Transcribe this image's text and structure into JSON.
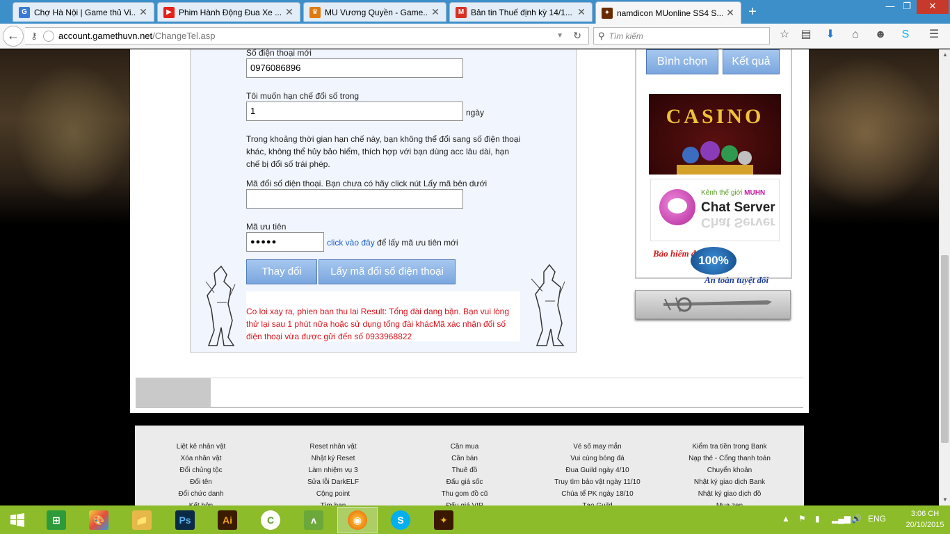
{
  "tabs": [
    {
      "title": "Chợ Hà Nội | Game thủ Vi...",
      "icon": "g-site-icon",
      "glyph": "G",
      "color": "#3a7bd5"
    },
    {
      "title": "Phim Hành Động Đua Xe ...",
      "icon": "youtube-icon",
      "glyph": "▶",
      "color": "#e62117"
    },
    {
      "title": "MU Vương Quyền - Game...",
      "icon": "crown-icon",
      "glyph": "♛",
      "color": "#e07a10"
    },
    {
      "title": "Bản tin Thuế định kỳ 14/1...",
      "icon": "gmail-icon",
      "glyph": "M",
      "color": "#d93025"
    },
    {
      "title": "namdicon MUonline SS4 S...",
      "icon": "mu-site-icon",
      "glyph": "✦",
      "color": "#6a2a00"
    }
  ],
  "address": {
    "host": "account.gamethuvn.net",
    "path": "/ChangeTel.asp"
  },
  "search": {
    "placeholder": "Tìm kiếm"
  },
  "form": {
    "new_phone_label": "Số điện thoại mới",
    "new_phone_value": "0976086896",
    "limit_label": "Tôi muốn hạn chế đổi số trong",
    "limit_value": "1",
    "limit_unit": "ngày",
    "limit_note": "Trong khoảng thời gian hạn chế này, bạn không thể đổi sang số điện thoại khác, không thể hủy bảo hiểm, thích hợp với bạn dùng acc lâu dài, hạn chế bị đổi số trái phép.",
    "code_label": "Mã đổi số điện thoại. Bạn chưa có hãy click nút Lấy mã bên dưới",
    "code_value": "",
    "priority_label": "Mã ưu tiên",
    "priority_value": "●●●●●",
    "priority_link": "click vào đây",
    "priority_hint": "để lấy mã ưu tiên mới",
    "change_button": "Thay đổi",
    "get_code_button": "Lấy mã đổi số điện thoại",
    "error_message": "Co loi xay ra, phien ban thu lai Result: Tổng đài đang bận. Bạn vui lòng thử lại sau 1 phút nữa hoặc sử dụng tổng đài khácMã xác nhận đổi số điện thoại vừa được gửi đến số 0933968822"
  },
  "sidebar": {
    "vote_button": "Bình chọn",
    "result_button": "Kết quả",
    "casino_text": "CASINO",
    "chat_kicker": "Kênh thế giới",
    "chat_brand": "MUHN",
    "chat_title": "Chat Server",
    "insurance_title": "Bảo hiểm đổ",
    "insurance_seal": "100%",
    "insurance_sub": "An toàn tuyệt đối"
  },
  "footer": {
    "columns": [
      [
        "Liệt kê nhân vật",
        "Xóa nhân vật",
        "Đổi chủng tộc",
        "Đổi tên",
        "Đổi chức danh",
        "Kết hôn"
      ],
      [
        "Reset nhân vật",
        "Nhật ký Reset",
        "Làm nhiệm vụ 3",
        "Sửa lỗi DarkELF",
        "Cộng point",
        "Tìm bạn"
      ],
      [
        "Cần mua",
        "Cần bán",
        "Thuê đồ",
        "Đấu giá sốc",
        "Thu gom đồ cũ",
        "Đấu giá VIP"
      ],
      [
        "Vé số may mắn",
        "Vui cùng bóng đá",
        "Đua Guild ngày 4/10",
        "Truy tìm bảo vật ngày 11/10",
        "Chúa tể PK ngày 18/10",
        "Tạo Guild"
      ],
      [
        "Kiểm tra tiền trong Bank",
        "Nạp thẻ - Cổng thanh toán",
        "Chuyển khoản",
        "Nhật ký giao dịch Bank",
        "Nhật ký giao dịch đồ",
        "Mua zen"
      ]
    ]
  },
  "taskbar": {
    "language": "ENG",
    "time": "3:06 CH",
    "date": "20/10/2015"
  }
}
